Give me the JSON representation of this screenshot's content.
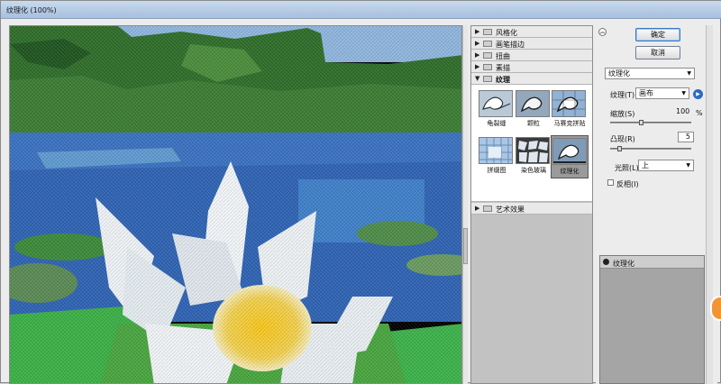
{
  "window": {
    "title": "纹理化 (100%)"
  },
  "gallery": {
    "categories": [
      "风格化",
      "画笔描边",
      "扭曲",
      "素描",
      "纹理",
      "艺术效果"
    ],
    "texture_filters": [
      "龟裂缝",
      "颗粒",
      "马赛克拼贴",
      "拼缀图",
      "染色玻璃",
      "纹理化"
    ],
    "selected_filter": "纹理化"
  },
  "buttons": {
    "ok": "确定",
    "cancel": "取消"
  },
  "settings": {
    "filter_select": "纹理化",
    "texture_label": "纹理(T):",
    "texture_value": "画布",
    "scale_label": "缩放(S)",
    "scale_value": "100",
    "scale_unit": "%",
    "relief_label": "凸现(R)",
    "relief_value": "5",
    "light_label": "光照(L):",
    "light_value": "上",
    "invert_label": "反相(I)",
    "invert_checked": false
  },
  "layers": {
    "items": [
      "纹理化"
    ]
  },
  "icons": {
    "collapse": "double-chevron-up-icon",
    "play": "play-circle-icon",
    "eye": "eye-icon",
    "folder": "folder-icon"
  }
}
